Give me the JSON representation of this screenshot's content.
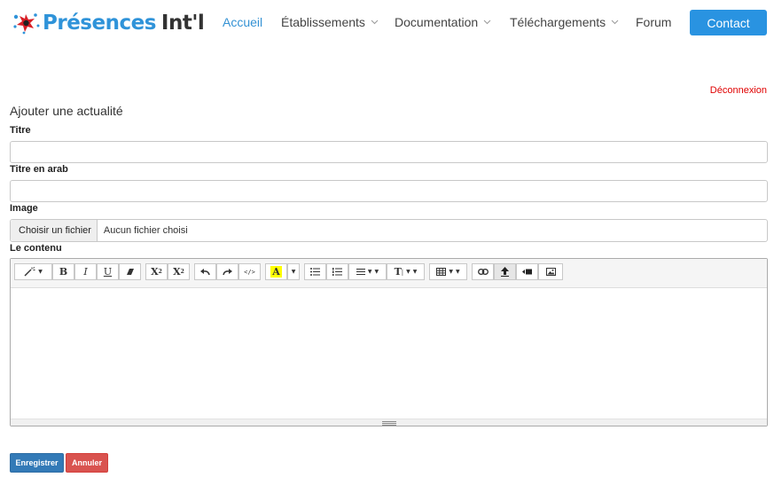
{
  "header": {
    "logo_word1": "Présences",
    "logo_word2": "Int'l",
    "nav": [
      {
        "label": "Accueil",
        "active": true
      },
      {
        "label": "Établissements",
        "dropdown": true
      },
      {
        "label": "Documentation",
        "dropdown": true
      },
      {
        "label": "Téléchargements",
        "dropdown": true
      },
      {
        "label": "Forum"
      }
    ],
    "contact_label": "Contact"
  },
  "logout_label": "Déconnexion",
  "form": {
    "title": "Ajouter une actualité",
    "titre_label": "Titre",
    "titre_value": "",
    "titre_arab_label": "Titre en arab",
    "titre_arab_value": "",
    "image_label": "Image",
    "file_button": "Choisir un fichier",
    "file_status": "Aucun fichier choisi",
    "contenu_label": "Le contenu",
    "save_label": "Enregistrer",
    "cancel_label": "Annuler"
  },
  "toolbar": {
    "bold": "B",
    "italic": "I",
    "underline": "U",
    "superscript": "X",
    "subscript": "X",
    "code": "</>",
    "font_size": "T",
    "highlight": "A"
  },
  "colors": {
    "brand_blue": "#2f93d9",
    "nav_active": "#3492d4",
    "contact_bg": "#2993e1",
    "logout_red": "#e00000",
    "save_bg": "#337ab7",
    "cancel_bg": "#d9534f"
  }
}
